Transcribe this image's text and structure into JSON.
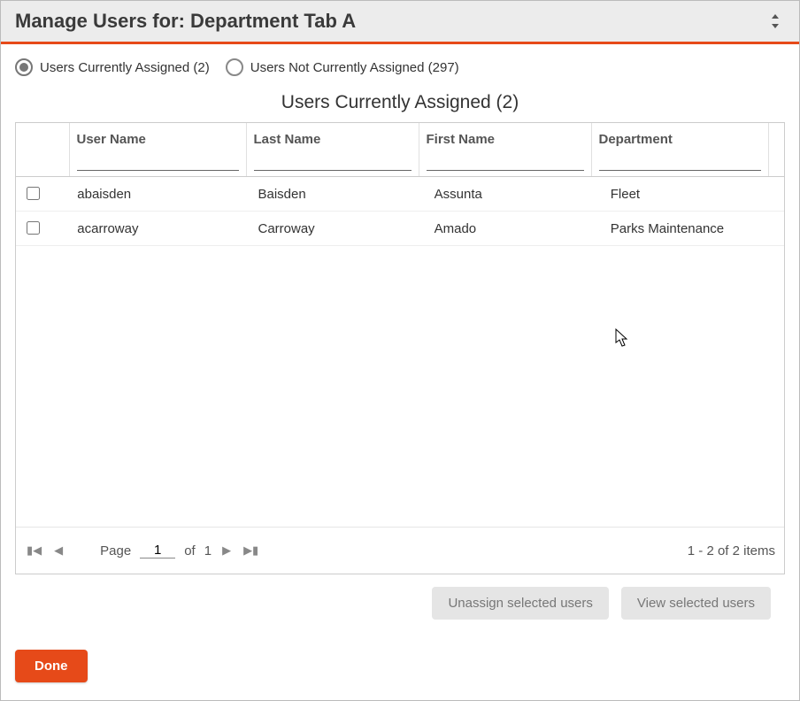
{
  "header": {
    "title": "Manage Users for: Department Tab A"
  },
  "filters": {
    "assigned_label": "Users Currently Assigned (2)",
    "not_assigned_label": "Users Not Currently Assigned (297)",
    "selected": "assigned"
  },
  "grid": {
    "title": "Users Currently Assigned (2)",
    "columns": {
      "user_name": "User Name",
      "last_name": "Last Name",
      "first_name": "First Name",
      "department": "Department"
    },
    "filter_values": {
      "user_name": "",
      "last_name": "",
      "first_name": "",
      "department": ""
    },
    "rows": [
      {
        "checked": false,
        "user_name": "abaisden",
        "last_name": "Baisden",
        "first_name": "Assunta",
        "department": "Fleet"
      },
      {
        "checked": false,
        "user_name": "acarroway",
        "last_name": "Carroway",
        "first_name": "Amado",
        "department": "Parks Maintenance"
      }
    ]
  },
  "pager": {
    "page_label": "Page",
    "current_page": "1",
    "of_label": "of",
    "total_pages": "1",
    "items_range": "1 - 2 of 2 items"
  },
  "actions": {
    "unassign_label": "Unassign selected users",
    "view_label": "View selected users"
  },
  "footer": {
    "done_label": "Done"
  }
}
